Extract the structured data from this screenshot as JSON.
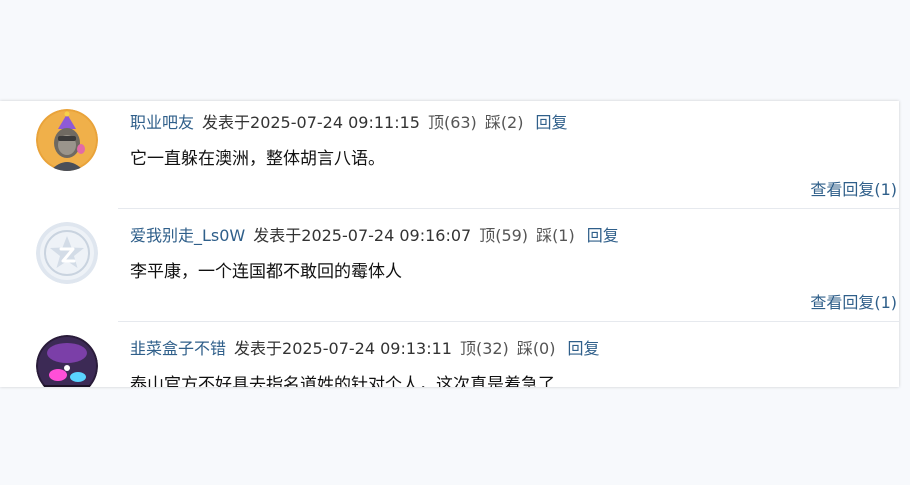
{
  "comments": [
    {
      "username": "职业吧友",
      "posted": "发表于2025-07-24 09:11:15",
      "up": "顶(63)",
      "down": "踩(2)",
      "reply": "回复",
      "content": "它一直躲在澳洲，整体胡言八语。",
      "view_replies": "查看回复(1)",
      "avatar": "cartoon-avatar-icon"
    },
    {
      "username": "爱我别走_Ls0W",
      "posted": "发表于2025-07-24 09:16:07",
      "up": "顶(59)",
      "down": "踩(1)",
      "reply": "回复",
      "content": "李平康，一个连国都不敢回的霉体人",
      "view_replies": "查看回复(1)",
      "avatar": "default-avatar-icon"
    },
    {
      "username": "韭菜盒子不错",
      "posted": "发表于2025-07-24 09:13:11",
      "up": "顶(32)",
      "down": "踩(0)",
      "reply": "回复",
      "content": "泰山官方不好具去指名道姓的针对个人，这次真是着急了",
      "avatar": "photo-avatar-icon"
    }
  ],
  "colors": {
    "link": "#2f5f8a",
    "text": "#111111",
    "page_background": "#f7f9fc",
    "card_background": "#ffffff"
  }
}
